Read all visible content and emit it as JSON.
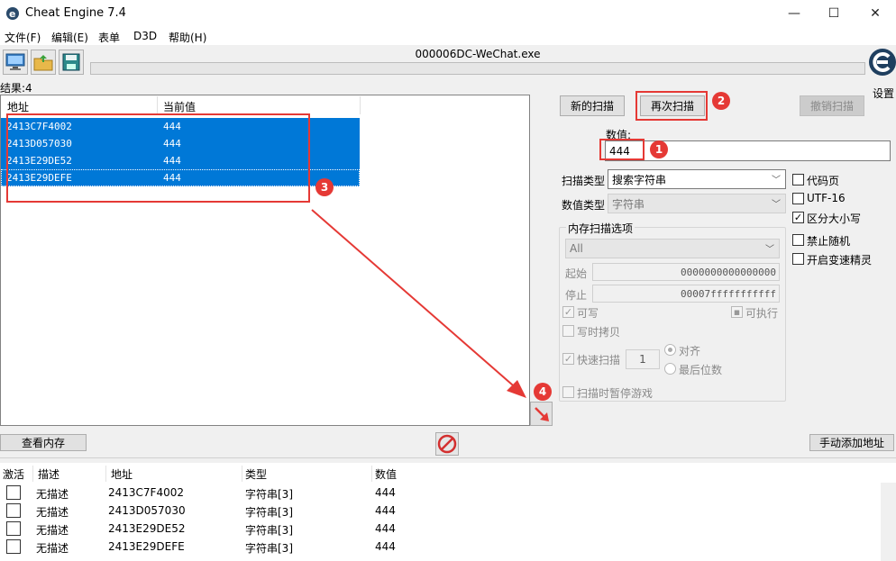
{
  "window": {
    "title": "Cheat Engine 7.4",
    "minimize": "—",
    "maximize": "☐",
    "close": "✕"
  },
  "menu": [
    "文件(F)",
    "编辑(E)",
    "表单",
    "D3D",
    "帮助(H)"
  ],
  "toolbar": {
    "icons": [
      "computer-process-icon",
      "open-folder-icon",
      "save-disk-icon"
    ]
  },
  "process": {
    "name": "000006DC-WeChat.exe",
    "progress": 0
  },
  "settings_label": "设置",
  "results": {
    "label": "结果:4",
    "columns": [
      "地址",
      "当前值"
    ],
    "rows": [
      {
        "address": "2413C7F4002",
        "value": "444"
      },
      {
        "address": "2413D057030",
        "value": "444"
      },
      {
        "address": "2413E29DE52",
        "value": "444"
      },
      {
        "address": "2413E29DEFE",
        "value": "444"
      }
    ]
  },
  "scan_buttons": {
    "new_scan": "新的扫描",
    "next_scan": "再次扫描",
    "undo_scan": "撤销扫描"
  },
  "value": {
    "label": "数值:",
    "input": "444"
  },
  "scan_type": {
    "label": "扫描类型",
    "selected": "搜索字符串"
  },
  "value_type": {
    "label": "数值类型",
    "selected": "字符串"
  },
  "memory_options": {
    "title": "内存扫描选项",
    "region": "All",
    "start_label": "起始",
    "start_value": "0000000000000000",
    "stop_label": "停止",
    "stop_value": "00007fffffffffff",
    "writable": "可写",
    "executable": "可执行",
    "copy_on_write": "写时拷贝",
    "fast_scan": "快速扫描",
    "fast_scan_value": "1",
    "align": "对齐",
    "last_digits": "最后位数",
    "pause_game": "扫描时暂停游戏"
  },
  "options": {
    "codepage": "代码页",
    "utf16": "UTF-16",
    "case_sensitive": "区分大小写",
    "no_random": "禁止随机",
    "speedhack": "开启变速精灵"
  },
  "annotations": [
    "1",
    "2",
    "3",
    "4"
  ],
  "view_memory": "查看内存",
  "add_address_manually": "手动添加地址",
  "address_list": {
    "columns": [
      "激活",
      "描述",
      "地址",
      "类型",
      "数值"
    ],
    "rows": [
      {
        "description": "无描述",
        "address": "2413C7F4002",
        "type": "字符串[3]",
        "value": "444"
      },
      {
        "description": "无描述",
        "address": "2413D057030",
        "type": "字符串[3]",
        "value": "444"
      },
      {
        "description": "无描述",
        "address": "2413E29DE52",
        "type": "字符串[3]",
        "value": "444"
      },
      {
        "description": "无描述",
        "address": "2413E29DEFE",
        "type": "字符串[3]",
        "value": "444"
      }
    ]
  },
  "colors": {
    "selection": "#0078d7",
    "annotation": "#e53935"
  }
}
